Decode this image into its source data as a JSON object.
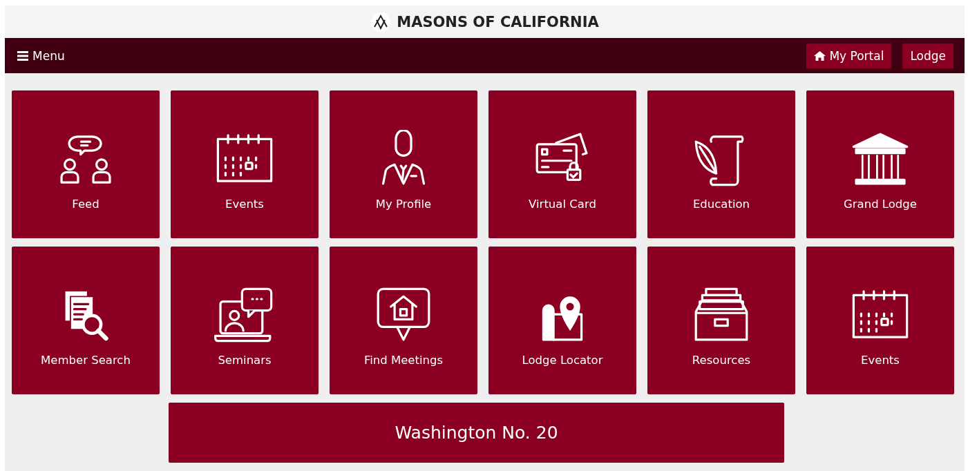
{
  "header": {
    "title": "MASONS OF CALIFORNIA"
  },
  "nav": {
    "menu": "Menu",
    "buttons": [
      "My Portal",
      "Lodge"
    ]
  },
  "tiles": [
    {
      "label": "Feed",
      "kind": "chat"
    },
    {
      "label": "Events",
      "kind": "calendar"
    },
    {
      "label": "My Profile",
      "kind": "person"
    },
    {
      "label": "Virtual Card",
      "kind": "card"
    },
    {
      "label": "Education",
      "kind": "scroll"
    },
    {
      "label": "Grand Lodge",
      "kind": "building"
    },
    {
      "label": "Member Search",
      "kind": "search"
    },
    {
      "label": "Seminars",
      "kind": "webinar"
    },
    {
      "label": "Find Meetings",
      "kind": "house"
    },
    {
      "label": "Lodge Locator",
      "kind": "pin"
    },
    {
      "label": "Resources",
      "kind": "drawer"
    },
    {
      "label": "Events",
      "kind": "calendar"
    }
  ],
  "banner": "Washington No. 20"
}
